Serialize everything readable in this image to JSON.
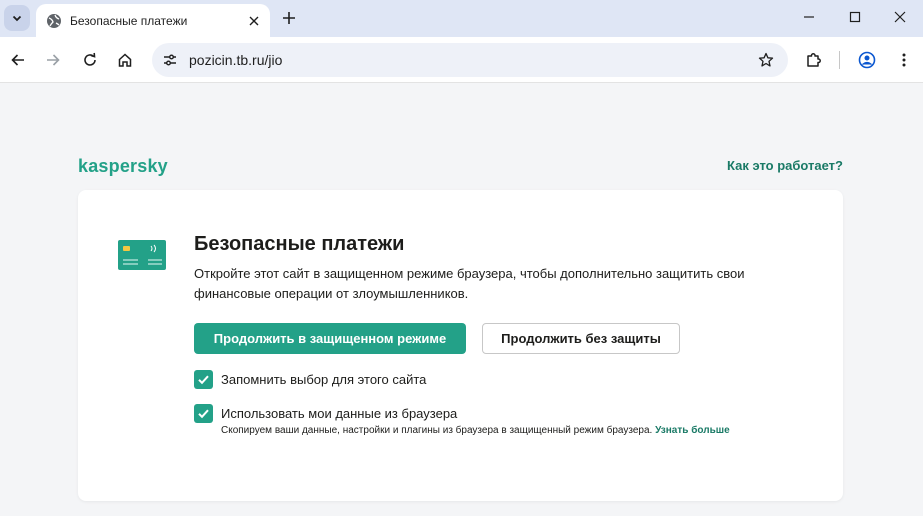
{
  "browser": {
    "tab_title": "Безопасные платежи",
    "url": "pozicin.tb.ru/jio"
  },
  "page": {
    "logo": "kaspersky",
    "how_it_works": "Как это работает?",
    "card": {
      "title": "Безопасные платежи",
      "description": "Откройте этот сайт в защищенном режиме браузера, чтобы дополнительно защитить свои финансовые операции от злоумышленников.",
      "primary_button": "Продолжить в защищенном режиме",
      "secondary_button": "Продолжить без защиты",
      "remember_choice": "Запомнить выбор для этого сайта",
      "use_browser_data": "Использовать мои данные из браузера",
      "browser_data_note": "Скопируем ваши данные, настройки и плагины из браузера в защищенный режим браузера.",
      "learn_more": "Узнать больше"
    }
  },
  "colors": {
    "accent": "#23a188",
    "link": "#1a7a66"
  }
}
